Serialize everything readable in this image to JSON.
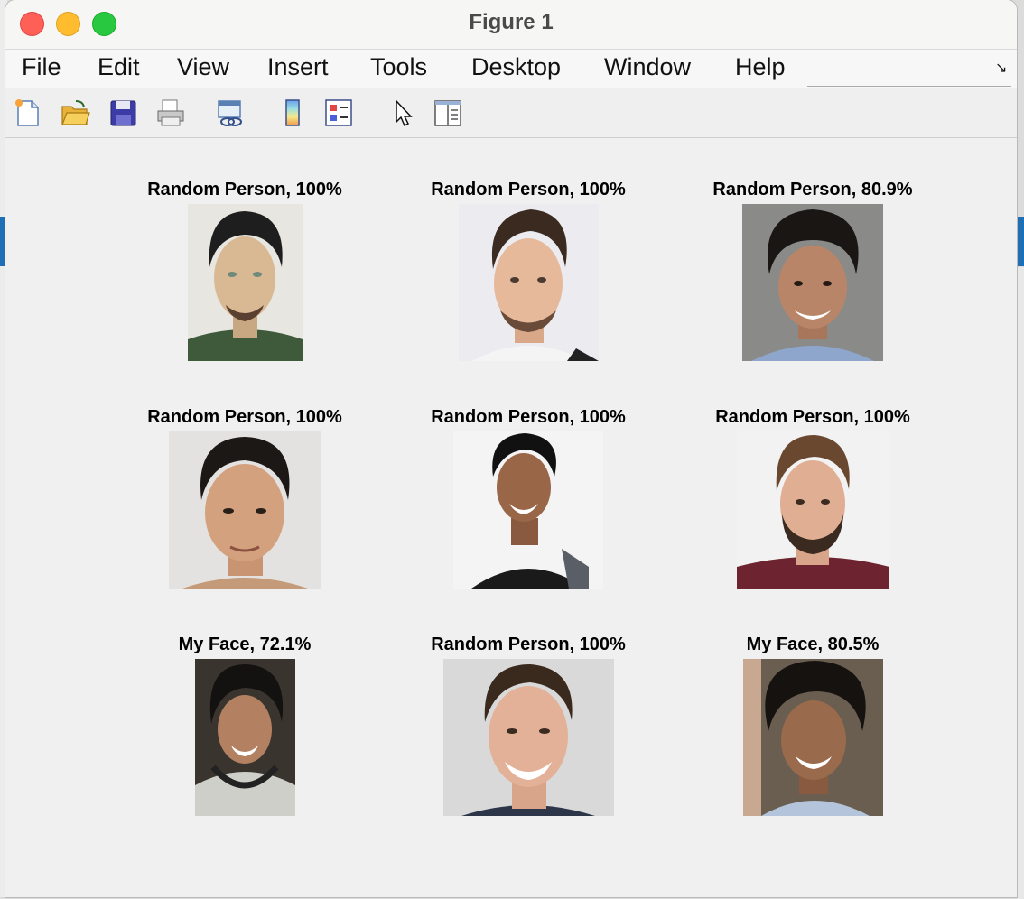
{
  "window": {
    "title": "Figure 1"
  },
  "menu": [
    "File",
    "Edit",
    "View",
    "Insert",
    "Tools",
    "Desktop",
    "Window",
    "Help"
  ],
  "toolbar": [
    "new-figure-icon",
    "open-file-icon",
    "save-icon",
    "print-icon",
    "link-plot-icon",
    "colorbar-icon",
    "legend-icon",
    "pointer-icon",
    "property-inspector-icon"
  ],
  "subplots": [
    {
      "title": "Random Person, 100%"
    },
    {
      "title": "Random Person, 100%"
    },
    {
      "title": "Random Person, 80.9%"
    },
    {
      "title": "Random Person, 100%"
    },
    {
      "title": "Random Person, 100%"
    },
    {
      "title": "Random Person, 100%"
    },
    {
      "title": "My Face, 72.1%"
    },
    {
      "title": "Random Person, 100%"
    },
    {
      "title": "My Face, 80.5%"
    }
  ],
  "colors": {
    "close": "#fe5f57",
    "minimize": "#febc2e",
    "zoom": "#28c840"
  }
}
